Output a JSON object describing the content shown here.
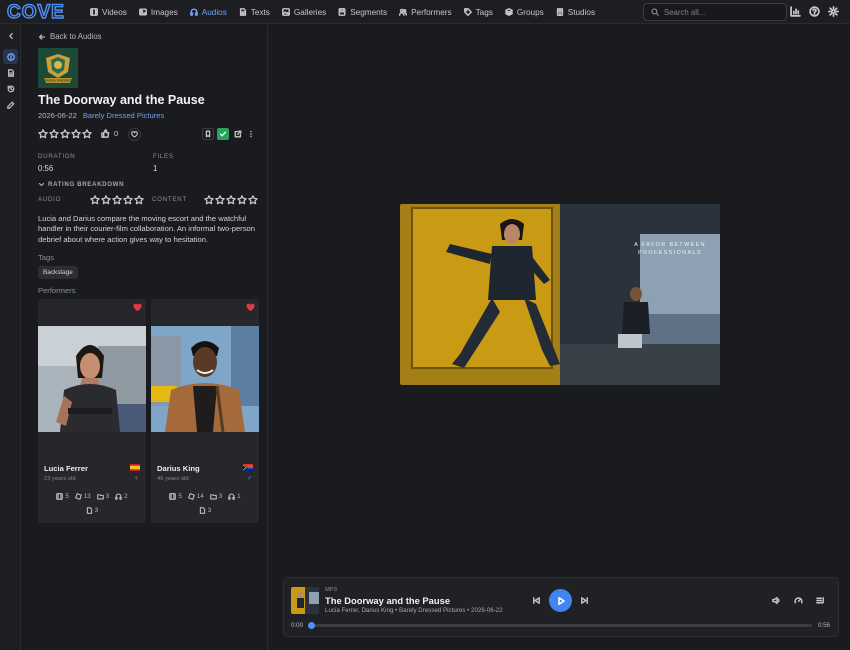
{
  "app": {
    "logo_text": "COVE"
  },
  "nav": [
    {
      "label": "Videos",
      "icon": "film-icon",
      "active": false
    },
    {
      "label": "Images",
      "icon": "image-icon",
      "active": false
    },
    {
      "label": "Audios",
      "icon": "headphones-icon",
      "active": true
    },
    {
      "label": "Texts",
      "icon": "document-icon",
      "active": false
    },
    {
      "label": "Galleries",
      "icon": "gallery-icon",
      "active": false
    },
    {
      "label": "Segments",
      "icon": "bookmark-icon",
      "active": false
    },
    {
      "label": "Performers",
      "icon": "users-icon",
      "active": false
    },
    {
      "label": "Tags",
      "icon": "tag-icon",
      "active": false
    },
    {
      "label": "Groups",
      "icon": "layers-icon",
      "active": false
    },
    {
      "label": "Studios",
      "icon": "building-icon",
      "active": false
    }
  ],
  "search": {
    "placeholder": "Search all..."
  },
  "top_icons": [
    "stats-icon",
    "help-icon",
    "settings-icon"
  ],
  "rail": [
    "collapse-icon",
    "info-icon",
    "document-icon",
    "history-icon",
    "edit-icon"
  ],
  "detail": {
    "back_label": "Back to Audios",
    "studio_logo_text": "BARELY DRESSED",
    "title": "The Doorway and the Pause",
    "date": "2026-06-22",
    "studio": "Barely Dressed Pictures",
    "rating": 0,
    "like_count": "0",
    "duration_label": "DURATION",
    "duration": "0:56",
    "files_label": "FILES",
    "files": "1",
    "breakdown_label": "RATING BREAKDOWN",
    "audio_label": "AUDIO",
    "content_label": "CONTENT",
    "description": "Lucia and Darius compare the moving escort and the watchful handler in their courier-film collaboration. An informal two-person debrief about where action gives way to hesitation.",
    "tags_label": "Tags",
    "tags": [
      "Backstage"
    ],
    "performers_label": "Performers"
  },
  "performers": [
    {
      "name": "Lucia Ferrer",
      "age": "23 years old",
      "flag": "spain",
      "gender": "female",
      "gender_glyph": "♀",
      "gender_color": "#e0628e",
      "stats": [
        "5",
        "13",
        "3",
        "2"
      ],
      "texts": "3",
      "favorite": true
    },
    {
      "name": "Darius King",
      "age": "46 years old",
      "flag": "south-africa",
      "gender": "male",
      "gender_glyph": "♂",
      "gender_color": "#5b9cf0",
      "stats": [
        "5",
        "14",
        "3",
        "1"
      ],
      "texts": "3",
      "favorite": true
    }
  ],
  "cover": {
    "caption_line1": "A FAVOR BETWEEN",
    "caption_line2": "PROFESSIONALS"
  },
  "player": {
    "format": "MP3",
    "title": "The Doorway and the Pause",
    "subtitle": "Lucia Ferrer, Darius King • Barely Dressed Pictures • 2026-06-22",
    "current_time": "0:00",
    "duration": "0:56",
    "progress": 0
  },
  "colors": {
    "accent": "#3f86f2",
    "link": "#6fa0f2",
    "favorite": "#e0393e",
    "check": "#2aa35a"
  }
}
